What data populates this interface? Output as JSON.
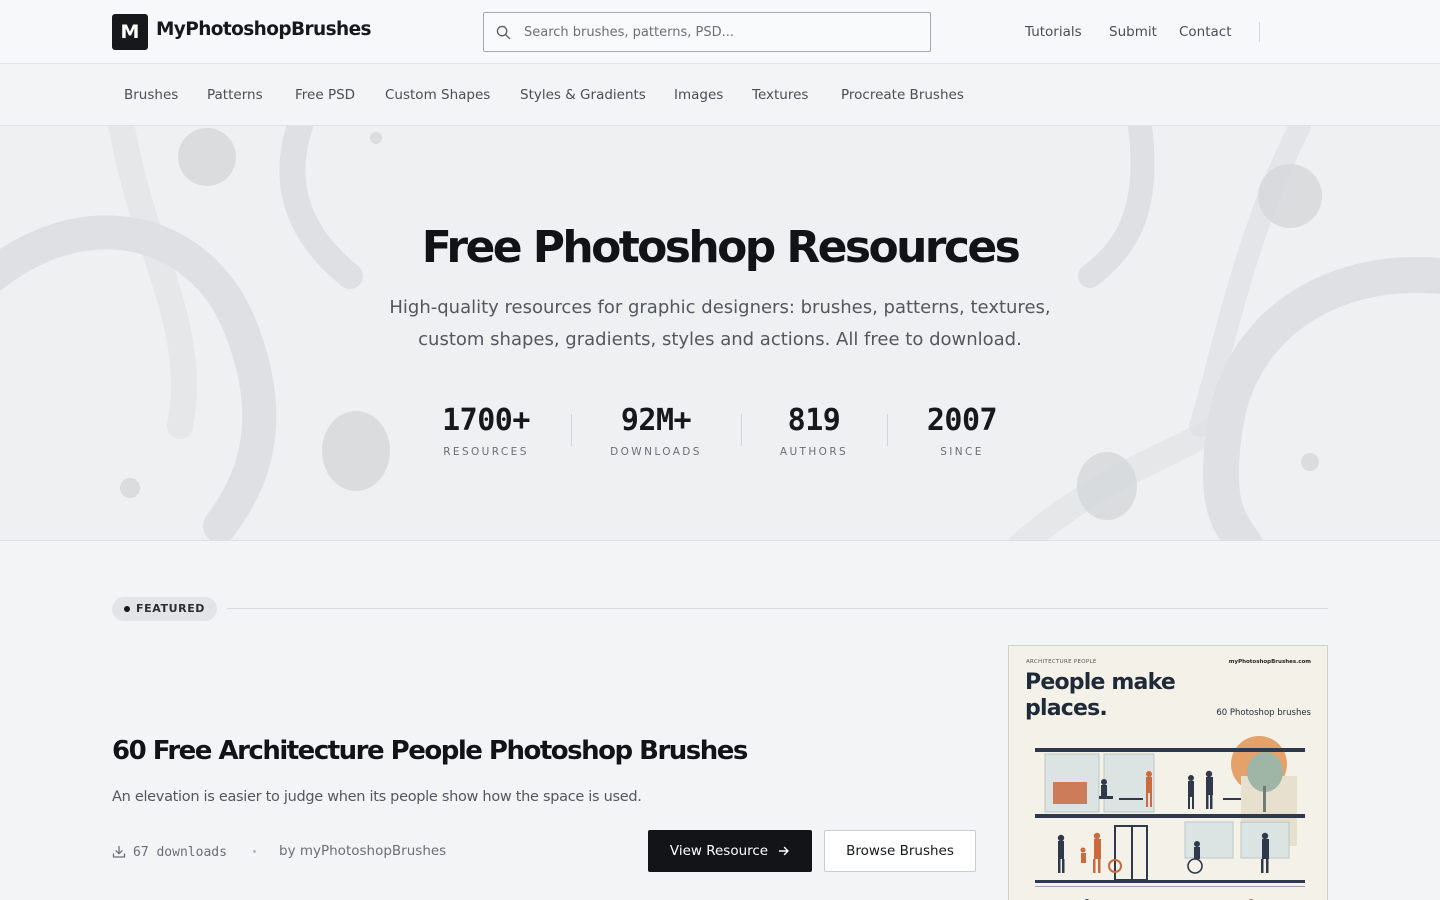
{
  "header": {
    "logo_letter": "M",
    "site_name": "MyPhotoshopBrushes",
    "search_placeholder": "Search brushes, patterns, PSD...",
    "links": [
      "Tutorials",
      "Submit",
      "Contact"
    ]
  },
  "categories": [
    "Brushes",
    "Patterns",
    "Free PSD",
    "Custom Shapes",
    "Styles & Gradients",
    "Images",
    "Textures",
    "Procreate Brushes"
  ],
  "hero": {
    "title": "Free Photoshop Resources",
    "subtitle": "High-quality resources for graphic designers: brushes, patterns, textures, custom shapes, gradients, styles and actions. All free to download.",
    "stats": [
      {
        "value": "1700+",
        "label": "RESOURCES"
      },
      {
        "value": "92M+",
        "label": "DOWNLOADS"
      },
      {
        "value": "819",
        "label": "AUTHORS"
      },
      {
        "value": "2007",
        "label": "SINCE"
      }
    ]
  },
  "featured": {
    "badge": "FEATURED",
    "title": "60 Free Architecture People Photoshop Brushes",
    "description": "An elevation is easier to judge when its people show how the space is used.",
    "downloads": "67 downloads",
    "author": "by myPhotoshopBrushes",
    "primary_button": "View Resource",
    "secondary_button": "Browse Brushes",
    "poster": {
      "kicker": "ARCHITECTURE PEOPLE",
      "site": "myPhotoshopBrushes.com",
      "headline": "People make places.",
      "count": "60 Photoshop brushes"
    }
  },
  "colors": {
    "brand_dark": "#131417",
    "accent_orange": "#c96a3f",
    "figure_navy": "#2e3a4c"
  }
}
